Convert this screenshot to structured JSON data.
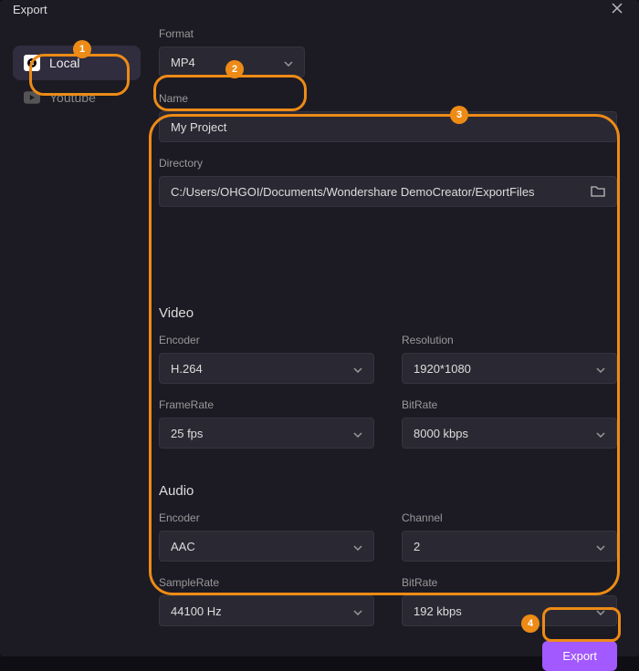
{
  "window": {
    "title": "Export"
  },
  "sidebar": {
    "items": [
      {
        "label": "Local"
      },
      {
        "label": "Youtube"
      }
    ]
  },
  "format": {
    "label": "Format",
    "value": "MP4"
  },
  "name": {
    "label": "Name",
    "value": "My Project"
  },
  "directory": {
    "label": "Directory",
    "value": "C:/Users/OHGOI/Documents/Wondershare DemoCreator/ExportFiles"
  },
  "video": {
    "title": "Video",
    "encoder": {
      "label": "Encoder",
      "value": "H.264"
    },
    "resolution": {
      "label": "Resolution",
      "value": "1920*1080"
    },
    "framerate": {
      "label": "FrameRate",
      "value": "25 fps"
    },
    "bitrate": {
      "label": "BitRate",
      "value": "8000 kbps"
    }
  },
  "audio": {
    "title": "Audio",
    "encoder": {
      "label": "Encoder",
      "value": "AAC"
    },
    "channel": {
      "label": "Channel",
      "value": "2"
    },
    "samplerate": {
      "label": "SampleRate",
      "value": "44100 Hz"
    },
    "bitrate": {
      "label": "BitRate",
      "value": "192 kbps"
    }
  },
  "footer": {
    "export": "Export"
  },
  "callouts": {
    "c1": "1",
    "c2": "2",
    "c3": "3",
    "c4": "4"
  }
}
